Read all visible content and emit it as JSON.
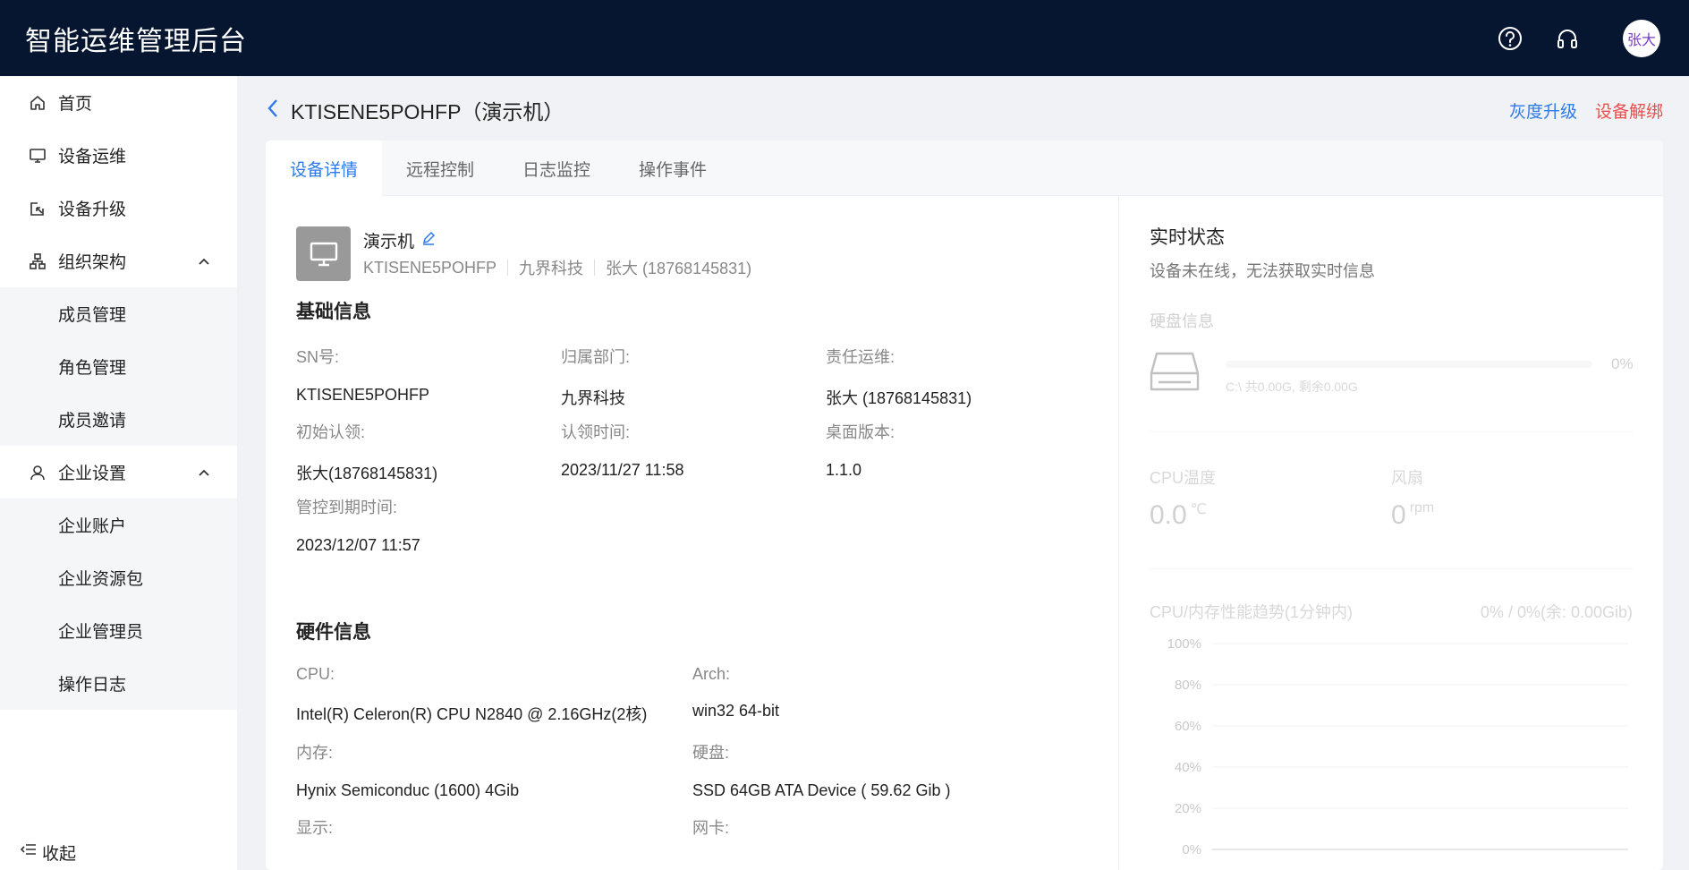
{
  "header": {
    "title": "智能运维管理后台",
    "avatar_text": "张大",
    "icons": [
      "help-icon",
      "headset-icon"
    ]
  },
  "sidebar": {
    "items": [
      {
        "label": "首页",
        "icon": "home-icon"
      },
      {
        "label": "设备运维",
        "icon": "monitor-icon"
      },
      {
        "label": "设备升级",
        "icon": "upgrade-icon"
      },
      {
        "label": "组织架构",
        "icon": "org-icon",
        "expanded": true,
        "children": [
          "成员管理",
          "角色管理",
          "成员邀请"
        ]
      },
      {
        "label": "企业设置",
        "icon": "user-icon",
        "expanded": true,
        "children": [
          "企业账户",
          "企业资源包",
          "企业管理员",
          "操作日志"
        ]
      }
    ],
    "collapse_label": "收起"
  },
  "page": {
    "title": "KTISENE5POHFP（演示机）",
    "actions": {
      "gray_upgrade": "灰度升级",
      "unbind": "设备解绑"
    }
  },
  "tabs": [
    {
      "label": "设备详情",
      "active": true
    },
    {
      "label": "远程控制",
      "active": false
    },
    {
      "label": "日志监控",
      "active": false
    },
    {
      "label": "操作事件",
      "active": false
    }
  ],
  "device": {
    "name": "演示机",
    "sn": "KTISENE5POHFP",
    "department": "九界科技",
    "owner": "张大 (18768145831)"
  },
  "basic_info": {
    "title": "基础信息",
    "fields": [
      {
        "label": "SN号:",
        "value": "KTISENE5POHFP"
      },
      {
        "label": "归属部门:",
        "value": "九界科技"
      },
      {
        "label": "责任运维:",
        "value": "张大 (18768145831)"
      },
      {
        "label": "初始认领:",
        "value": "张大(18768145831)"
      },
      {
        "label": "认领时间:",
        "value": "2023/11/27 11:58"
      },
      {
        "label": "桌面版本:",
        "value": "1.1.0"
      },
      {
        "label": "管控到期时间:",
        "value": "2023/12/07 11:57"
      }
    ]
  },
  "hardware_info": {
    "title": "硬件信息",
    "fields": [
      {
        "label": "CPU:",
        "value": "Intel(R) Celeron(R) CPU N2840 @ 2.16GHz(2核)"
      },
      {
        "label": "Arch:",
        "value": "win32 64-bit"
      },
      {
        "label": "内存:",
        "value": "Hynix Semiconduc (1600) 4Gib"
      },
      {
        "label": "硬盘:",
        "value": "SSD 64GB ATA Device ( 59.62 Gib )"
      },
      {
        "label": "显示:",
        "value": ""
      },
      {
        "label": "网卡:",
        "value": ""
      }
    ]
  },
  "realtime": {
    "title": "实时状态",
    "subtitle": "设备未在线，无法获取实时信息",
    "disk_label": "硬盘信息",
    "disk_pct": "0%",
    "disk_info": "C:\\ 共0.00G, 剩余0.00G",
    "cpu_temp_label": "CPU温度",
    "cpu_temp_value": "0.0",
    "cpu_temp_unit": "℃",
    "fan_label": "风扇",
    "fan_value": "0",
    "fan_unit": "rpm",
    "trend_label": "CPU/内存性能趋势(1分钟内)",
    "trend_value": "0% / 0%(余: 0.00Gib)"
  },
  "chart_data": {
    "type": "line",
    "title": "",
    "ylim": [
      0,
      100
    ],
    "y_ticks": [
      "100%",
      "80%",
      "60%",
      "40%",
      "20%",
      "0%"
    ],
    "series": []
  }
}
